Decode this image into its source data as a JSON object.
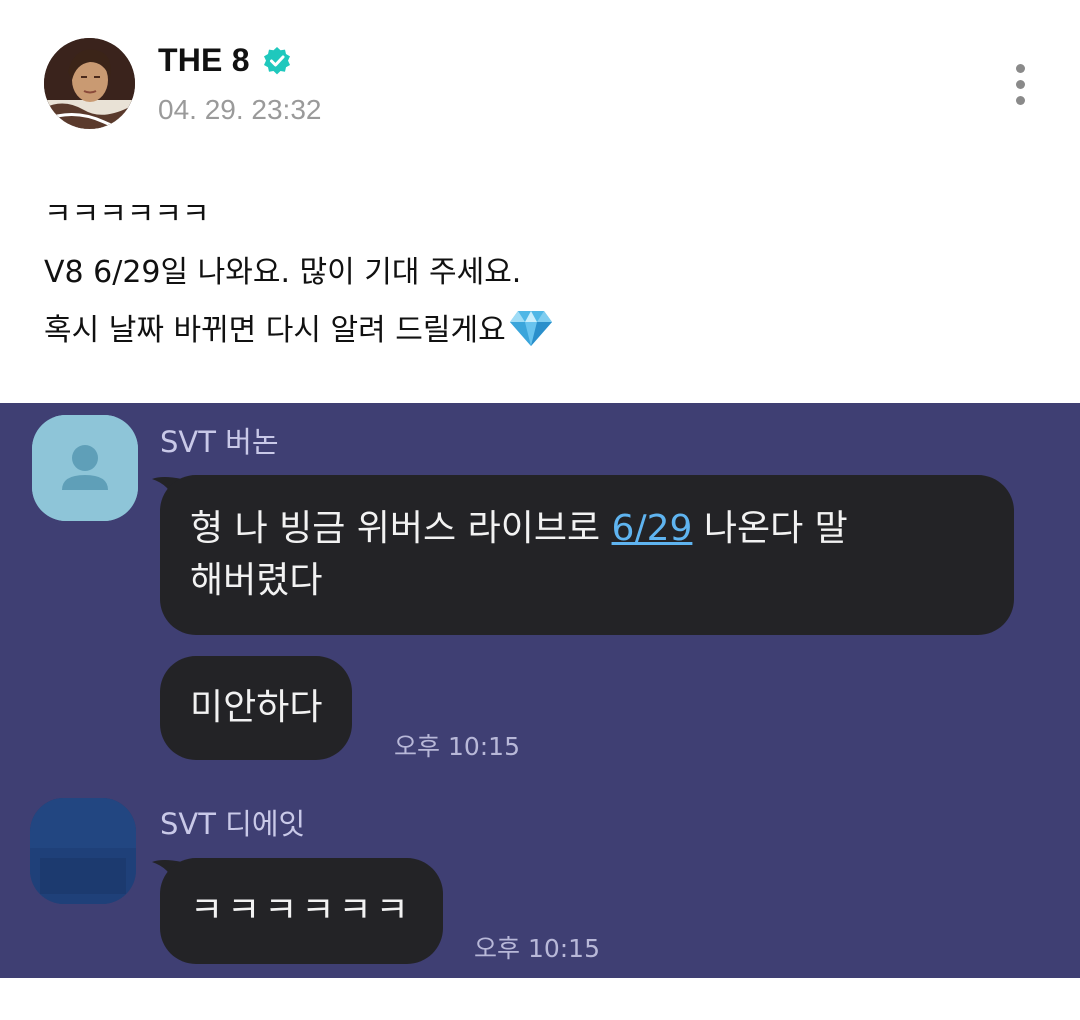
{
  "post": {
    "author": "THE 8",
    "timestamp": "04. 29. 23:32",
    "lines": [
      "ㅋㅋㅋㅋㅋㅋ",
      "V8 6/29일 나와요. 많이 기대 주세요.",
      "혹시 날짜 바뀌면 다시 알려 드릴게요"
    ],
    "emoji_icon": "gem-icon"
  },
  "chat": {
    "messages": [
      {
        "sender": "SVT 버논",
        "bubble1_before": "형 나 빙금 위버스 라이브로 ",
        "bubble1_link": "6/29",
        "bubble1_after": " 나온다 말",
        "bubble1_line2": "해버렸다",
        "bubble2": "미안하다",
        "time": "오후 10:15"
      },
      {
        "sender": "SVT 디에잇",
        "bubble1": "ㅋㅋㅋㅋㅋㅋ",
        "time": "오후 10:15"
      }
    ]
  },
  "colors": {
    "chat_background": "#3f3f73",
    "bubble": "#232326",
    "link": "#5fb4f0",
    "verified": "#1fc8bd"
  }
}
